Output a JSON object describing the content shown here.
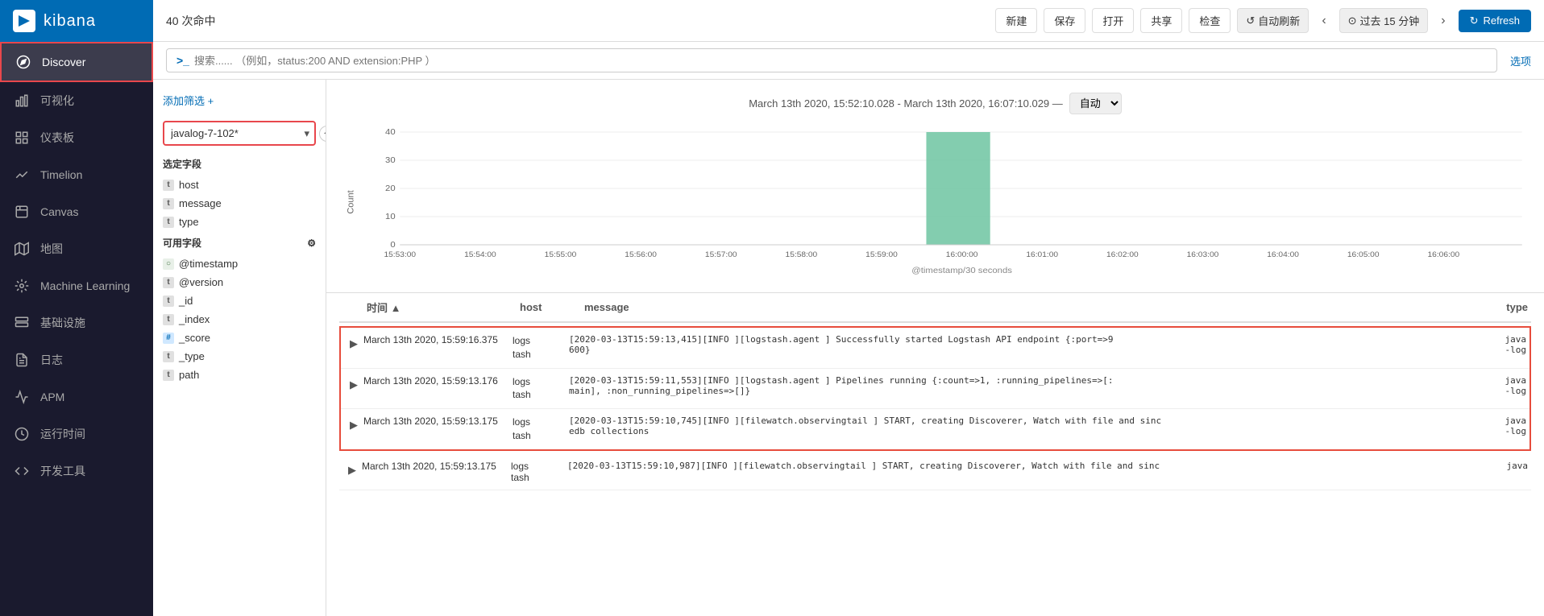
{
  "app": {
    "name": "kibana"
  },
  "sidebar": {
    "items": [
      {
        "id": "discover",
        "label": "Discover",
        "icon": "compass",
        "active": true
      },
      {
        "id": "visualize",
        "label": "可视化",
        "icon": "bar-chart"
      },
      {
        "id": "dashboard",
        "label": "仪表板",
        "icon": "grid"
      },
      {
        "id": "timelion",
        "label": "Timelion",
        "icon": "timelion"
      },
      {
        "id": "canvas",
        "label": "Canvas",
        "icon": "canvas"
      },
      {
        "id": "maps",
        "label": "地图",
        "icon": "map"
      },
      {
        "id": "ml",
        "label": "Machine Learning",
        "icon": "ml"
      },
      {
        "id": "infra",
        "label": "基础设施",
        "icon": "infra"
      },
      {
        "id": "logs",
        "label": "日志",
        "icon": "logs"
      },
      {
        "id": "apm",
        "label": "APM",
        "icon": "apm"
      },
      {
        "id": "uptime",
        "label": "运行时间",
        "icon": "uptime"
      },
      {
        "id": "devtools",
        "label": "开发工具",
        "icon": "devtools"
      }
    ]
  },
  "toolbar": {
    "count_label": "40 次命中",
    "new_label": "新建",
    "save_label": "保存",
    "open_label": "打开",
    "share_label": "共享",
    "inspect_label": "检查",
    "auto_refresh_label": "自动刷新",
    "prev_label": "‹",
    "next_label": "›",
    "time_range": "⊙ 过去 15 分钟",
    "refresh_label": "Refresh"
  },
  "search": {
    "prefix": ">_",
    "placeholder": "搜索...... （例如，status:200 AND extension:PHP ）",
    "options_label": "选项"
  },
  "left_panel": {
    "filter_add_label": "添加筛选 +",
    "index_pattern": "javalog-7-102*",
    "selected_fields_title": "选定字段",
    "available_fields_title": "可用字段",
    "selected_fields": [
      {
        "type": "t",
        "name": "host"
      },
      {
        "type": "t",
        "name": "message"
      },
      {
        "type": "t",
        "name": "type"
      }
    ],
    "available_fields": [
      {
        "type": "circle",
        "name": "@timestamp"
      },
      {
        "type": "t",
        "name": "@version"
      },
      {
        "type": "t",
        "name": "_id"
      },
      {
        "type": "t",
        "name": "_index"
      },
      {
        "type": "hash",
        "name": "_score"
      },
      {
        "type": "t",
        "name": "_type"
      },
      {
        "type": "t",
        "name": "path"
      }
    ]
  },
  "chart": {
    "time_range": "March 13th 2020, 15:52:10.028 - March 13th 2020, 16:07:10.029 —",
    "auto_label": "自动",
    "y_label": "Count",
    "x_axis": [
      "15:53:00",
      "15:54:00",
      "15:55:00",
      "15:56:00",
      "15:57:00",
      "15:58:00",
      "15:59:00",
      "16:00:00",
      "16:01:00",
      "16:02:00",
      "16:03:00",
      "16:04:00",
      "16:05:00",
      "16:06:00"
    ],
    "x_sub_label": "@timestamp/30 seconds",
    "y_axis": [
      0,
      10,
      20,
      30,
      40
    ],
    "bar_data": [
      0,
      0,
      0,
      0,
      0,
      0,
      40,
      0,
      0,
      0,
      0,
      0,
      0,
      0
    ]
  },
  "table": {
    "col_time": "时间",
    "col_host": "host",
    "col_message": "message",
    "col_type": "type",
    "rows": [
      {
        "time": "March 13th 2020, 15:59:16.375",
        "host": "logs\ntash",
        "message": "[2020-03-13T15:59:13,415][INFO ][logstash.agent             ] Successfully started Logstash API endpoint {:port=>9600}",
        "type": "java\n-log",
        "highlighted": true
      },
      {
        "time": "March 13th 2020, 15:59:13.176",
        "host": "logs\ntash",
        "message": "[2020-03-13T15:59:11,553][INFO ][logstash.agent             main], :non_running_pipelines=>[]}",
        "type": "java\n-log",
        "highlighted": true
      },
      {
        "time": "March 13th 2020, 15:59:13.175",
        "host": "logs\ntash",
        "message": "[2020-03-13T15:59:10,745][INFO ][filewatch.observingtail    ] START, creating Discoverer, Watch with file and sinc\nedb collections",
        "type": "java\n-log",
        "highlighted": true
      },
      {
        "time": "March 13th 2020, 15:59:13.175",
        "host": "logs\ntash",
        "message": "[2020-03-13T15:59:10,987][INFO ][filewatch.observingtail    ] START, creating Discoverer, Watch with file and sinc",
        "type": "java",
        "highlighted": false
      }
    ]
  }
}
